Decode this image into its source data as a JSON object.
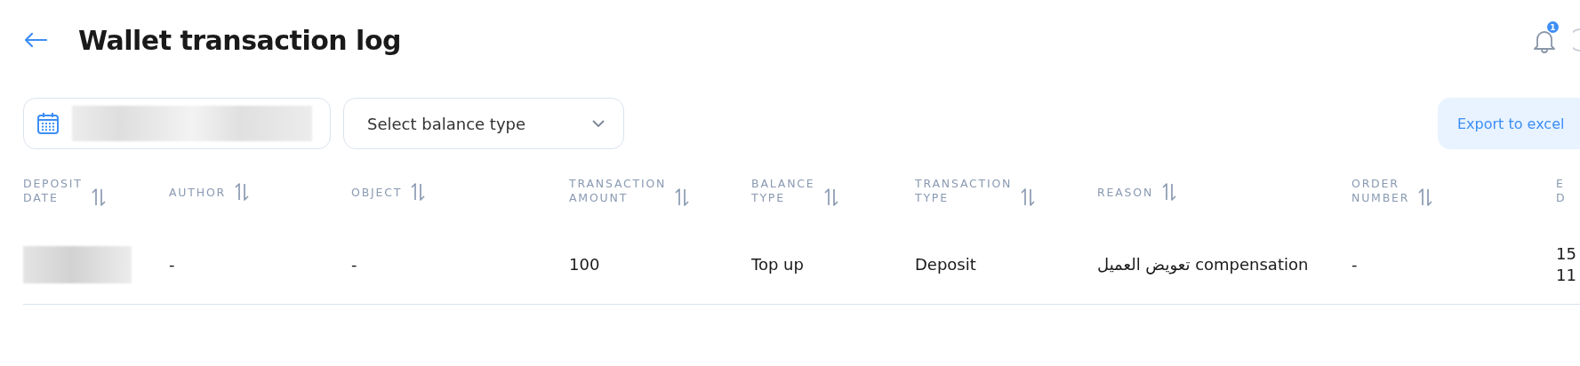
{
  "header": {
    "title": "Wallet transaction log",
    "notifications": {
      "badge": "1"
    }
  },
  "filters": {
    "balance_type": {
      "placeholder": "Select balance type"
    },
    "export_button": "Export to excel"
  },
  "table": {
    "columns": [
      {
        "lines": [
          "DEPOSIT",
          "DATE"
        ]
      },
      {
        "lines": [
          "AUTHOR"
        ]
      },
      {
        "lines": [
          "OBJECT"
        ]
      },
      {
        "lines": [
          "TRANSACTION",
          "AMOUNT"
        ]
      },
      {
        "lines": [
          "BALANCE",
          "TYPE"
        ]
      },
      {
        "lines": [
          "TRANSACTION",
          "TYPE"
        ]
      },
      {
        "lines": [
          "REASON"
        ]
      },
      {
        "lines": [
          "ORDER",
          "NUMBER"
        ]
      },
      {
        "lines": [
          "E",
          "D"
        ]
      }
    ],
    "rows": [
      {
        "cells": [
          {
            "kind": "blurred"
          },
          {
            "kind": "text",
            "lines": [
              "-"
            ]
          },
          {
            "kind": "text",
            "lines": [
              "-"
            ]
          },
          {
            "kind": "text",
            "lines": [
              "100"
            ]
          },
          {
            "kind": "text",
            "lines": [
              "Top up"
            ]
          },
          {
            "kind": "text",
            "lines": [
              "Deposit"
            ]
          },
          {
            "kind": "text",
            "lines": [
              "تعويض العميل compensation"
            ]
          },
          {
            "kind": "text",
            "lines": [
              "-"
            ]
          },
          {
            "kind": "text",
            "lines": [
              "15",
              "11"
            ]
          }
        ]
      }
    ]
  }
}
